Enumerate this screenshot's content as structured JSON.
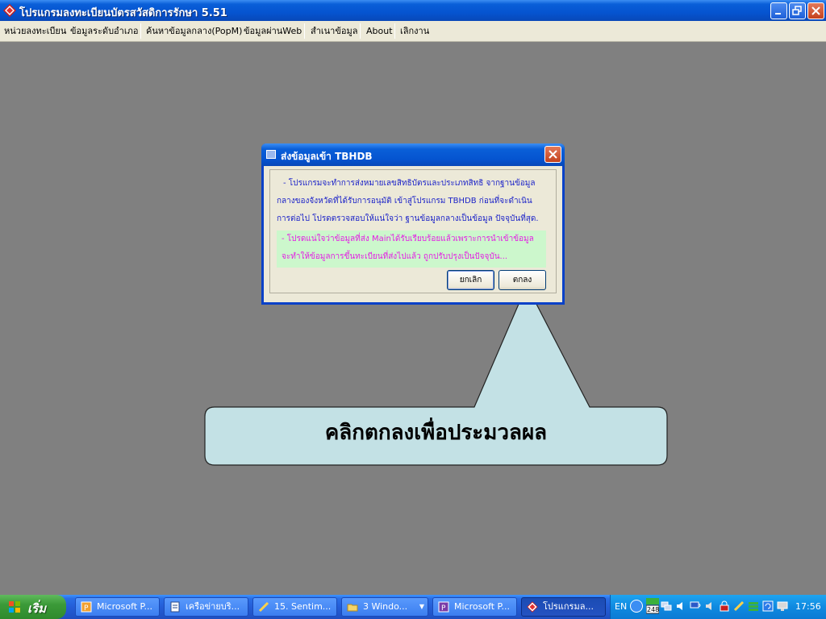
{
  "window": {
    "title": "โปรแกรมลงทะเบียนบัตรสวัสดิการรักษา 5.51"
  },
  "menu": {
    "items": [
      {
        "label": "หน่วยลงทะเบียน"
      },
      {
        "label": "ข้อมูลระดับอำเภอ"
      },
      {
        "label": "ค้นหาข้อมูลกลาง(PopM)"
      },
      {
        "label": "ข้อมูลผ่านWeb"
      },
      {
        "label": "สำเนาข้อมูล"
      },
      {
        "label": "About"
      },
      {
        "label": "เลิกงาน"
      }
    ]
  },
  "dialog": {
    "title": "ส่งข้อมูลเข้า TBHDB",
    "message_lines": [
      "- โปรแกรมจะทำการส่งหมายเลขสิทธิบัตรและประเภทสิทธิ จากฐานข้อมูล",
      "กลางของจังหวัดที่ได้รับการอนุมัติ เข้าสู่โปรแกรม TBHDB ก่อนที่จะดำเนิน",
      "การต่อไป โปรดตรวจสอบให้แน่ใจว่า ฐานข้อมูลกลางเป็นข้อมูล ปัจจุบันที่สุด."
    ],
    "warning_lines": [
      "- โปรดแน่ใจว่าข้อมูลที่ส่ง Mainได้รับเรียบร้อยแล้วเพราะการนำเข้าข้อมูล",
      "จะทำให้ข้อมูลการขึ้นทะเบียนที่ส่งไปแล้ว ถูกปรับปรุงเป็นปัจจุบัน..."
    ],
    "cancel_label": "ยกเลิก",
    "ok_label": "ตกลง"
  },
  "callout": {
    "text": "คลิกตกลงเพื่อประมวลผล"
  },
  "taskbar": {
    "start_label": "เริ่ม",
    "tasks": [
      {
        "label": "Microsoft P...",
        "icon": "powerpoint-icon"
      },
      {
        "label": "เครือข่ายบริ...",
        "icon": "document-icon"
      },
      {
        "label": "15. Sentim...",
        "icon": "word-icon"
      },
      {
        "label": "3 Windo...",
        "icon": "folder-icon"
      },
      {
        "label": "Microsoft P...",
        "icon": "powerpoint-icon"
      },
      {
        "label": "โปรแกรมล...",
        "icon": "app-icon"
      }
    ],
    "tray": {
      "lang": "EN",
      "badge": "248",
      "clock": "17:56"
    }
  },
  "colors": {
    "desktop": "#808080",
    "xp_blue": "#0554d0",
    "dialog_text": "#1c23c8",
    "warning_text": "#e41de4",
    "warning_bg": "#ccf7cc",
    "callout_fill": "#c3e1e5"
  }
}
